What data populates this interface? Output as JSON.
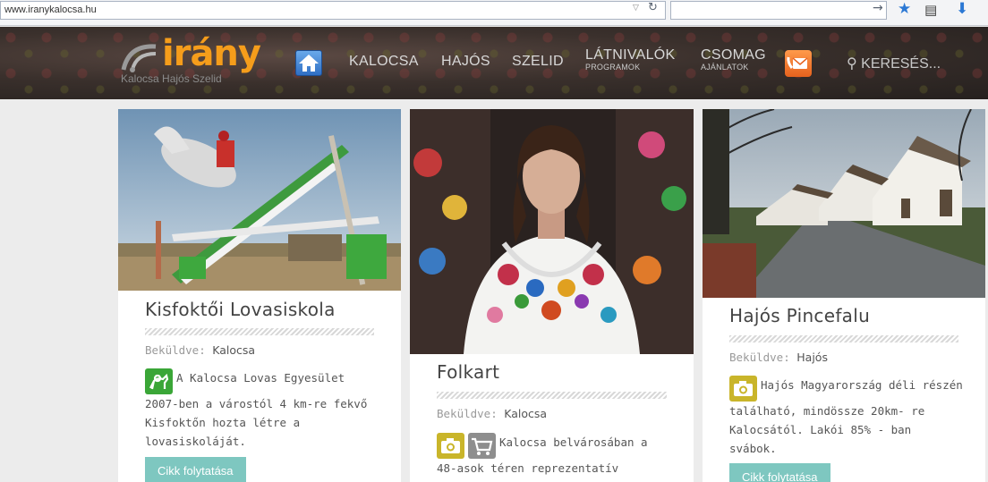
{
  "browser": {
    "url": "www.iranykalocsa.hu"
  },
  "site": {
    "logo": "irány",
    "tagline": "Kalocsa Hajós Szelid",
    "nav": [
      {
        "label": "KALOCSA",
        "sub": ""
      },
      {
        "label": "HAJÓS",
        "sub": ""
      },
      {
        "label": "SZELID",
        "sub": ""
      },
      {
        "label": "LÁTNIVALÓK",
        "sub": "PROGRAMOK"
      },
      {
        "label": "CSOMAG",
        "sub": "AJÁNLATOK"
      }
    ],
    "search_label": "KERESÉS..."
  },
  "cards": [
    {
      "title": "Kisfoktői Lovasiskola",
      "meta_label": "Beküldve:",
      "meta_value": "Kalocsa",
      "desc": "A Kalocsa Lovas Egyesület 2007-ben a várostól 4 km-re fekvő Kisfoktőn hozta létre a lovasiskoláját.",
      "button": "Cikk folytatása",
      "icon": "horse-riding-icon"
    },
    {
      "title": "Folkart",
      "meta_label": "Beküldve:",
      "meta_value": "Kalocsa",
      "desc": "Kalocsa belvárosában a 48-asok téren reprezentatív",
      "icon": "camera-icon",
      "icon2": "shopping-cart-icon"
    },
    {
      "title": "Hajós Pincefalu",
      "meta_label": "Beküldve:",
      "meta_value": "Hajós",
      "desc": "Hajós Magyarország déli részén található, mindössze 20km- re Kalocsától. Lakói 85% - ban svábok.",
      "button": "Cikk folytatása",
      "icon": "camera-icon"
    }
  ],
  "colors": {
    "accent_orange": "#f59d1b",
    "button_teal": "#7ec7c0",
    "icon_green": "#3aa637",
    "icon_olive": "#c9b52a"
  }
}
